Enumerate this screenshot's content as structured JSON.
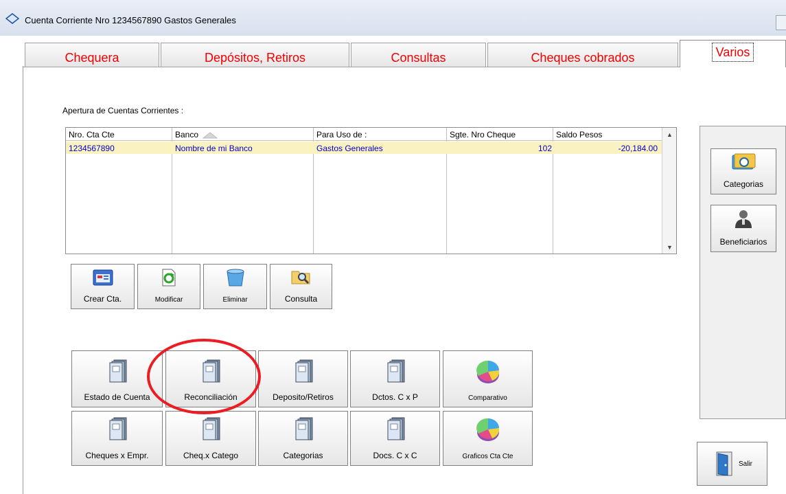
{
  "window": {
    "title": "Cuenta Corriente Nro 1234567890 Gastos Generales"
  },
  "tabs": [
    {
      "label": "Chequera"
    },
    {
      "label": "Depósitos, Retiros"
    },
    {
      "label": "Consultas"
    },
    {
      "label": "Cheques cobrados"
    },
    {
      "label": "Varios",
      "active": true
    }
  ],
  "accounts": {
    "section_label": "Apertura de Cuentas Corrientes :",
    "columns": [
      "Nro. Cta Cte",
      "Banco",
      "Para Uso de :",
      "Sgte. Nro Cheque",
      "Saldo Pesos"
    ],
    "rows": [
      [
        "1234567890",
        "Nombre de mi Banco",
        "Gastos Generales",
        "102",
        "-20,184.00"
      ]
    ]
  },
  "account_actions": [
    {
      "label": "Crear Cta.",
      "icon": "create-account-icon"
    },
    {
      "label": "Modificar",
      "icon": "refresh-document-icon"
    },
    {
      "label": "Eliminar",
      "icon": "trash-bin-icon"
    },
    {
      "label": "Consulta",
      "icon": "folder-search-icon"
    }
  ],
  "reports": [
    {
      "label": "Estado de Cuenta",
      "icon": "notebook-icon"
    },
    {
      "label": "Reconciliación",
      "icon": "notebook-icon"
    },
    {
      "label": "Deposito/Retiros",
      "icon": "notebook-icon"
    },
    {
      "label": "Dctos. C x P",
      "icon": "notebook-icon"
    },
    {
      "label": "Comparativo",
      "icon": "pie-chart-icon"
    },
    {
      "label": "Cheques x Empr.",
      "icon": "notebook-icon"
    },
    {
      "label": "Cheq.x Catego",
      "icon": "notebook-icon"
    },
    {
      "label": "Categorias",
      "icon": "notebook-icon"
    },
    {
      "label": "Docs. C x C",
      "icon": "notebook-icon"
    },
    {
      "label": "Graficos Cta Cte",
      "icon": "pie-chart-icon"
    }
  ],
  "side_panel": [
    {
      "label": "Categorias",
      "icon": "categories-icon"
    },
    {
      "label": "Beneficiarios",
      "icon": "person-icon"
    }
  ],
  "exit": {
    "label": "Salir",
    "icon": "exit-door-icon"
  },
  "colors": {
    "tab_text": "#f00000",
    "row_highlight": "#fbf2c2",
    "row_text": "#0000cc",
    "annotation": "#ec1c24"
  }
}
